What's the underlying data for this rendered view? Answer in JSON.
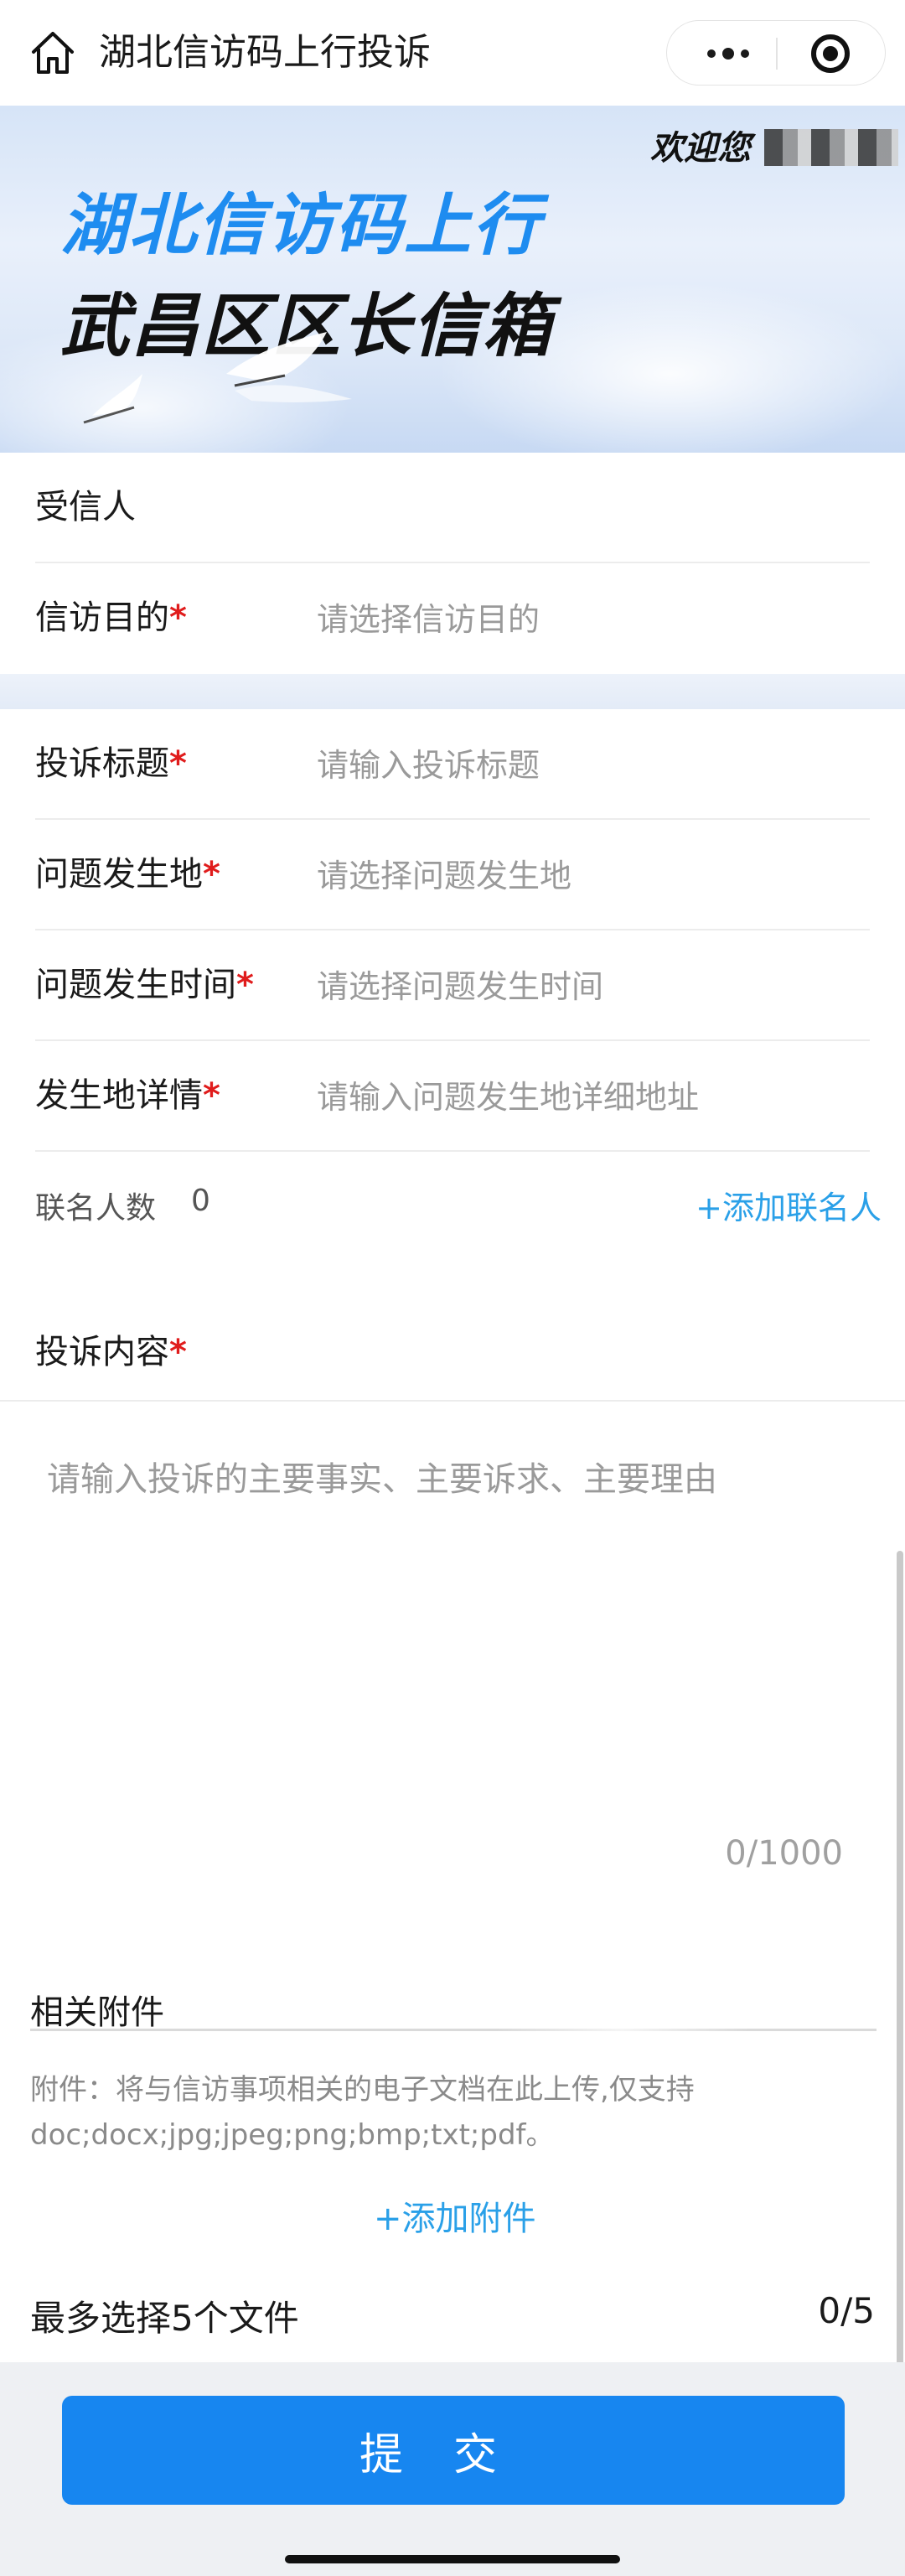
{
  "nav": {
    "title": "湖北信访码上行投诉"
  },
  "banner": {
    "welcome": "欢迎您",
    "title_line1": "湖北信访码上行",
    "title_line2": "武昌区区长信箱"
  },
  "group1": {
    "recipient_label": "受信人",
    "purpose_label": "信访目的",
    "purpose_placeholder": "请选择信访目的"
  },
  "group2": {
    "rows": [
      {
        "label": "投诉标题",
        "placeholder": "请输入投诉标题"
      },
      {
        "label": "问题发生地",
        "placeholder": "请选择问题发生地"
      },
      {
        "label": "问题发生时间",
        "placeholder": "请选择问题发生时间"
      },
      {
        "label": "发生地详情",
        "placeholder": "请输入问题发生地详细地址"
      }
    ],
    "required_mark": "*"
  },
  "cosign": {
    "label": "联名人数",
    "count": "0",
    "add_label": "+添加联名人"
  },
  "content": {
    "label": "投诉内容",
    "placeholder": "请输入投诉的主要事实、主要诉求、主要理由",
    "counter": "0/1000"
  },
  "attachments": {
    "title": "相关附件",
    "tip": "附件：将与信访事项相关的电子文档在此上传,仅支持doc;docx;jpg;jpeg;png;bmp;txt;pdf。",
    "add_label": "+添加附件",
    "max_label": "最多选择5个文件",
    "count": "0/5"
  },
  "footer": {
    "submit_label": "提交"
  },
  "colors": {
    "accent": "#1786f0",
    "link": "#2aa0e8",
    "required": "#e01c1c"
  }
}
